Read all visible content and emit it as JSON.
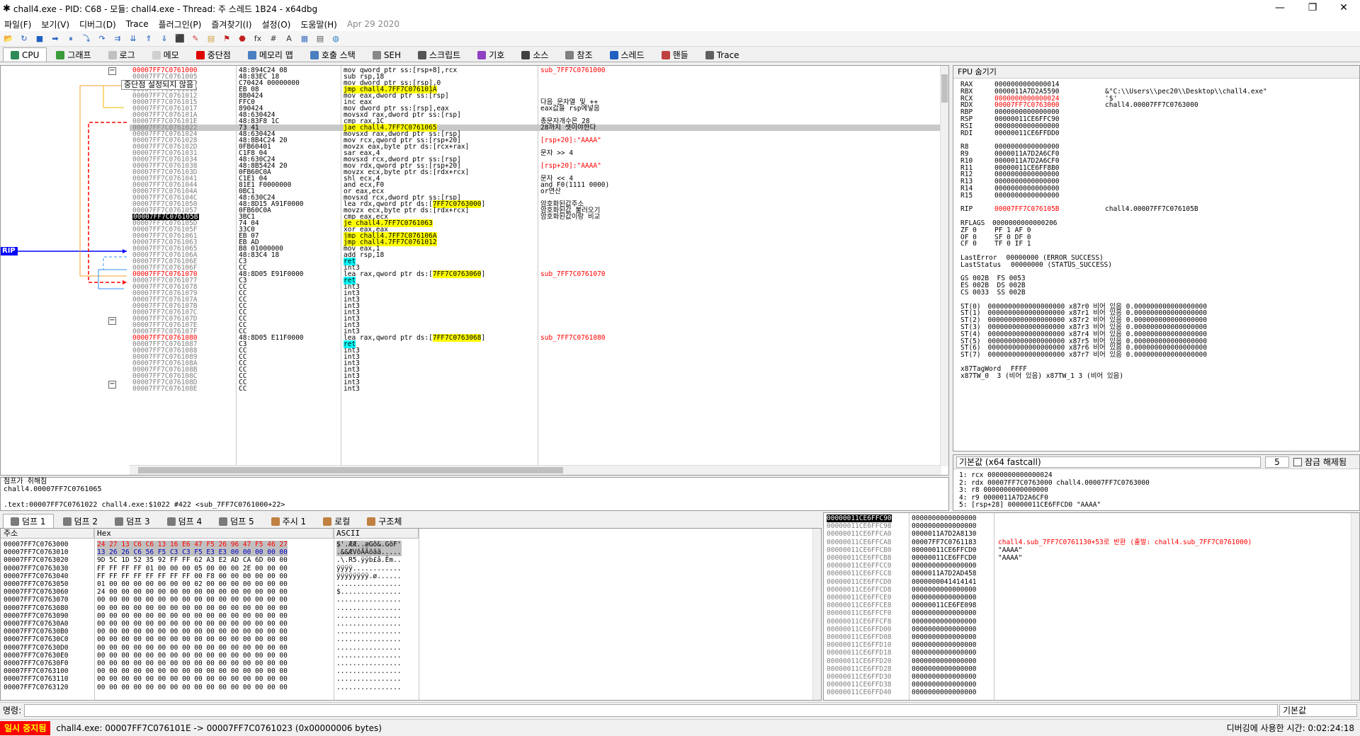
{
  "window": {
    "title": "chall4.exe - PID: C68 - 모듈: chall4.exe - Thread: 주 스레드 1B24 - x64dbg",
    "minimize": "—",
    "maximize": "❐",
    "close": "✕"
  },
  "menu": [
    "파일(F)",
    "보기(V)",
    "디버그(D)",
    "Trace",
    "플러그인(P)",
    "즐겨찾기(I)",
    "설정(O)",
    "도움말(H)"
  ],
  "build_date": "Apr 29 2020",
  "toolbar_icons": [
    "open-icon",
    "restart-icon",
    "stop-icon",
    "run-icon",
    "pause-icon",
    "step-into-icon",
    "step-over-icon",
    "trace-into-icon",
    "trace-over-icon",
    "execute-till-return-icon",
    "skip-icon",
    "breakpoint-icon",
    "patch-icon",
    "memory-icon",
    "script-icon",
    "hardware-bp-icon",
    "function-icon",
    "hash-icon",
    "font-icon",
    "calc-icon",
    "log-icon",
    "globe-icon"
  ],
  "toolbar_glyphs": [
    "📂",
    "↻",
    "■",
    "➡",
    "⏸",
    "⤵",
    "↷",
    "⇉",
    "⇊",
    "⇑",
    "⇓",
    "⬛",
    "✎",
    "▤",
    "⚑",
    "⬣",
    "fx",
    "#",
    "A",
    "▦",
    "▤",
    "◍"
  ],
  "tabs": [
    {
      "label": "CPU",
      "color": "#2e8b57"
    },
    {
      "label": "그래프",
      "color": "#3a9a3a"
    },
    {
      "label": "로그",
      "color": "#c0c0c0"
    },
    {
      "label": "메모",
      "color": "#d0d0d0"
    },
    {
      "label": "중단점",
      "color": "#e00000"
    },
    {
      "label": "메모리 맵",
      "color": "#4a7fc0"
    },
    {
      "label": "호출 스택",
      "color": "#4a7fc0"
    },
    {
      "label": "SEH",
      "color": "#888888"
    },
    {
      "label": "스크립트",
      "color": "#555555"
    },
    {
      "label": "기호",
      "color": "#9040c0"
    },
    {
      "label": "소스",
      "color": "#404040"
    },
    {
      "label": "참조",
      "color": "#808080"
    },
    {
      "label": "스레드",
      "color": "#2060c0"
    },
    {
      "label": "핸들",
      "color": "#c04040"
    },
    {
      "label": "Trace",
      "color": "#606060"
    }
  ],
  "tooltip": "중단점 설정되지 않음",
  "rip_label": "RIP",
  "disasm": [
    {
      "addr": "00007FF7C0761000",
      "bytes": "48:894C24 08",
      "ins": "mov qword ptr ss:[rsp+8],rcx",
      "cmt": "sub_7FF7C0761000",
      "addr_style": "red",
      "cmt_style": "red"
    },
    {
      "addr": "00007FF7C0761005",
      "bytes": "48:83EC 18",
      "ins": "sub rsp,18",
      "cmt": ""
    },
    {
      "addr": "00007FF7C0761009",
      "bytes": "C70424 00000000",
      "ins": "mov dword ptr ss:[rsp],0",
      "cmt": ""
    },
    {
      "addr": "00007FF7C0761010",
      "bytes": "EB 08",
      "ins": "jmp chall4.7FF7C076101A",
      "cmt": "",
      "ins_style": "jmp"
    },
    {
      "addr": "00007FF7C0761012",
      "bytes": "8B0424",
      "ins": "mov eax,dword ptr ss:[rsp]",
      "cmt": ""
    },
    {
      "addr": "00007FF7C0761015",
      "bytes": "FFC0",
      "ins": "inc eax",
      "cmt": "다음 문자열 및 ++"
    },
    {
      "addr": "00007FF7C0761017",
      "bytes": "890424",
      "ins": "mov dword ptr ss:[rsp],eax",
      "cmt": "eax값을 rsp에넣음"
    },
    {
      "addr": "00007FF7C076101A",
      "bytes": "48:630424",
      "ins": "movsxd rax,dword ptr ss:[rsp]",
      "cmt": ""
    },
    {
      "addr": "00007FF7C076101E",
      "bytes": "48:83F8 1C",
      "ins": "cmp rax,1C",
      "cmt": "총문자개수은 28"
    },
    {
      "addr": "00007FF7C0761022",
      "bytes": "73 41",
      "ins": "jae chall4.7FF7C0761065",
      "cmt": "28까지 셋이야한다",
      "ins_style": "jmp",
      "row_style": "hl"
    },
    {
      "addr": "00007FF7C0761024",
      "bytes": "48:630424",
      "ins": "movsxd rax,dword ptr ss:[rsp]",
      "cmt": ""
    },
    {
      "addr": "00007FF7C0761028",
      "bytes": "48:8B4C24 20",
      "ins": "mov rcx,qword ptr ss:[rsp+20]",
      "cmt": "[rsp+20]:\"AAAA\"",
      "cmt_style": "red"
    },
    {
      "addr": "00007FF7C076102D",
      "bytes": "0FB60401",
      "ins": "movzx eax,byte ptr ds:[rcx+rax]",
      "cmt": ""
    },
    {
      "addr": "00007FF7C0761031",
      "bytes": "C1F8 04",
      "ins": "sar eax,4",
      "cmt": "문자 >> 4"
    },
    {
      "addr": "00007FF7C0761034",
      "bytes": "48:630C24",
      "ins": "movsxd rcx,dword ptr ss:[rsp]",
      "cmt": ""
    },
    {
      "addr": "00007FF7C0761038",
      "bytes": "48:8B5424 20",
      "ins": "mov rdx,qword ptr ss:[rsp+20]",
      "cmt": "[rsp+20]:\"AAAA\"",
      "cmt_style": "red"
    },
    {
      "addr": "00007FF7C076103D",
      "bytes": "0FB60C0A",
      "ins": "movzx ecx,byte ptr ds:[rdx+rcx]",
      "cmt": ""
    },
    {
      "addr": "00007FF7C0761041",
      "bytes": "C1E1 04",
      "ins": "shl ecx,4",
      "cmt": "문자 << 4"
    },
    {
      "addr": "00007FF7C0761044",
      "bytes": "81E1 F0000000",
      "ins": "and ecx,F0",
      "cmt": "and F0(1111 0000)"
    },
    {
      "addr": "00007FF7C076104A",
      "bytes": "0BC1",
      "ins": "or eax,ecx",
      "cmt": " or연산"
    },
    {
      "addr": "00007FF7C076104C",
      "bytes": "48:630C24",
      "ins": "movsxd rcx,dword ptr ss:[rsp]",
      "cmt": ""
    },
    {
      "addr": "00007FF7C0761050",
      "bytes": "48:8D15 A91F0000",
      "ins": "lea rdx,qword ptr ds:[7FF7C0763000]",
      "cmt": "암호화된값주소",
      "ins_style": "addr"
    },
    {
      "addr": "00007FF7C0761057",
      "bytes": "0FB60C0A",
      "ins": "movzx ecx,byte ptr ds:[rdx+rcx]",
      "cmt": "암호화된값 불러오기"
    },
    {
      "addr": "00007FF7C076105B",
      "bytes": "3BC1",
      "ins": "cmp eax,ecx",
      "cmt": "암호화된값이랑 비교",
      "addr_style": "rip"
    },
    {
      "addr": "00007FF7C076105D",
      "bytes": "74 04",
      "ins": "je chall4.7FF7C0761063",
      "cmt": "",
      "ins_style": "jmp"
    },
    {
      "addr": "00007FF7C076105F",
      "bytes": "33C0",
      "ins": "xor eax,eax",
      "cmt": ""
    },
    {
      "addr": "00007FF7C0761061",
      "bytes": "EB 07",
      "ins": "jmp chall4.7FF7C076106A",
      "cmt": "",
      "ins_style": "jmp"
    },
    {
      "addr": "00007FF7C0761063",
      "bytes": "EB AD",
      "ins": "jmp chall4.7FF7C0761012",
      "cmt": "",
      "ins_style": "jmp"
    },
    {
      "addr": "00007FF7C0761065",
      "bytes": "B8 01000000",
      "ins": "mov eax,1",
      "cmt": ""
    },
    {
      "addr": "00007FF7C076106A",
      "bytes": "48:83C4 18",
      "ins": "add rsp,18",
      "cmt": ""
    },
    {
      "addr": "00007FF7C076106E",
      "bytes": "C3",
      "ins": "ret",
      "cmt": "",
      "ins_style": "ret"
    },
    {
      "addr": "00007FF7C076106F",
      "bytes": "CC",
      "ins": "int3",
      "cmt": ""
    },
    {
      "addr": "00007FF7C0761070",
      "bytes": "48:8D05 E91F0000",
      "ins": "lea rax,qword ptr ds:[7FF7C0763060]",
      "cmt": "sub_7FF7C0761070",
      "addr_style": "red",
      "cmt_style": "red",
      "ins_style": "addr"
    },
    {
      "addr": "00007FF7C0761077",
      "bytes": "C3",
      "ins": "ret",
      "cmt": "",
      "ins_style": "ret"
    },
    {
      "addr": "00007FF7C0761078",
      "bytes": "CC",
      "ins": "int3",
      "cmt": ""
    },
    {
      "addr": "00007FF7C0761079",
      "bytes": "CC",
      "ins": "int3",
      "cmt": ""
    },
    {
      "addr": "00007FF7C076107A",
      "bytes": "CC",
      "ins": "int3",
      "cmt": ""
    },
    {
      "addr": "00007FF7C076107B",
      "bytes": "CC",
      "ins": "int3",
      "cmt": ""
    },
    {
      "addr": "00007FF7C076107C",
      "bytes": "CC",
      "ins": "int3",
      "cmt": ""
    },
    {
      "addr": "00007FF7C076107D",
      "bytes": "CC",
      "ins": "int3",
      "cmt": ""
    },
    {
      "addr": "00007FF7C076107E",
      "bytes": "CC",
      "ins": "int3",
      "cmt": ""
    },
    {
      "addr": "00007FF7C076107F",
      "bytes": "CC",
      "ins": "int3",
      "cmt": ""
    },
    {
      "addr": "00007FF7C0761080",
      "bytes": "48:8D05 E11F0000",
      "ins": "lea rax,qword ptr ds:[7FF7C0763068]",
      "cmt": "sub_7FF7C0761080",
      "addr_style": "red",
      "cmt_style": "red",
      "ins_style": "addr"
    },
    {
      "addr": "00007FF7C0761087",
      "bytes": "C3",
      "ins": "ret",
      "cmt": "",
      "ins_style": "ret"
    },
    {
      "addr": "00007FF7C0761088",
      "bytes": "CC",
      "ins": "int3",
      "cmt": ""
    },
    {
      "addr": "00007FF7C0761089",
      "bytes": "CC",
      "ins": "int3",
      "cmt": ""
    },
    {
      "addr": "00007FF7C076108A",
      "bytes": "CC",
      "ins": "int3",
      "cmt": ""
    },
    {
      "addr": "00007FF7C076108B",
      "bytes": "CC",
      "ins": "int3",
      "cmt": ""
    },
    {
      "addr": "00007FF7C076108C",
      "bytes": "CC",
      "ins": "int3",
      "cmt": ""
    },
    {
      "addr": "00007FF7C076108D",
      "bytes": "CC",
      "ins": "int3",
      "cmt": ""
    },
    {
      "addr": "00007FF7C076108E",
      "bytes": "CC",
      "ins": "int3",
      "cmt": ""
    }
  ],
  "registers": {
    "header": "FPU 숨기기",
    "rows": [
      {
        "name": "RAX",
        "value": "0000000000000014",
        "info": ""
      },
      {
        "name": "RBX",
        "value": "0000011A7D2A5590",
        "info": "&\"C:\\\\Users\\\\pec20\\\\Desktop\\\\chall4.exe\""
      },
      {
        "name": "RCX",
        "value": "0000000000000024",
        "info": "'$'",
        "changed": true
      },
      {
        "name": "RDX",
        "value": "00007FF7C0763000",
        "info": "chall4.00007FF7C0763000",
        "changed": true
      },
      {
        "name": "RBP",
        "value": "0000000000000000",
        "info": ""
      },
      {
        "name": "RSP",
        "value": "00000011CE6FFC90",
        "info": ""
      },
      {
        "name": "RSI",
        "value": "0000000000000000",
        "info": ""
      },
      {
        "name": "RDI",
        "value": "00000011CE6FFDD0",
        "info": ""
      },
      {
        "name": "",
        "value": "",
        "info": ""
      },
      {
        "name": "R8",
        "value": "0000000000000000",
        "info": ""
      },
      {
        "name": "R9",
        "value": "0000011A7D2A6CF0",
        "info": ""
      },
      {
        "name": "R10",
        "value": "0000011A7D2A6CF0",
        "info": ""
      },
      {
        "name": "R11",
        "value": "00000011CE6FF8B0",
        "info": ""
      },
      {
        "name": "R12",
        "value": "0000000000000000",
        "info": ""
      },
      {
        "name": "R13",
        "value": "0000000000000000",
        "info": ""
      },
      {
        "name": "R14",
        "value": "0000000000000000",
        "info": ""
      },
      {
        "name": "R15",
        "value": "0000000000000000",
        "info": ""
      },
      {
        "name": "",
        "value": "",
        "info": ""
      },
      {
        "name": "RIP",
        "value": "00007FF7C076105B",
        "info": "chall4.00007FF7C076105B",
        "changed": true
      },
      {
        "name": "",
        "value": "",
        "info": ""
      },
      {
        "name": "RFLAGS",
        "value": "0000000000000206",
        "info": ""
      },
      {
        "name": "ZF 0",
        "value": "PF 1  AF 0",
        "info": ""
      },
      {
        "name": "OF 0",
        "value": "SF 0  DF 0",
        "info": ""
      },
      {
        "name": "CF 0",
        "value": "TF 0  IF 1",
        "info": ""
      },
      {
        "name": "",
        "value": "",
        "info": ""
      },
      {
        "name": "LastError",
        "value": "00000000 (ERROR_SUCCESS)",
        "info": ""
      },
      {
        "name": "LastStatus",
        "value": "00000000 (STATUS_SUCCESS)",
        "info": ""
      },
      {
        "name": "",
        "value": "",
        "info": ""
      },
      {
        "name": "GS 002B",
        "value": "FS 0053",
        "info": ""
      },
      {
        "name": "ES 002B",
        "value": "DS 002B",
        "info": ""
      },
      {
        "name": "CS 0033",
        "value": "SS 002B",
        "info": ""
      },
      {
        "name": "",
        "value": "",
        "info": ""
      },
      {
        "name": "ST(0)",
        "value": "0000000000000000000 x87r0 비어 있음 0.000000000000000000",
        "info": ""
      },
      {
        "name": "ST(1)",
        "value": "0000000000000000000 x87r1 비어 있음 0.000000000000000000",
        "info": ""
      },
      {
        "name": "ST(2)",
        "value": "0000000000000000000 x87r2 비어 있음 0.000000000000000000",
        "info": ""
      },
      {
        "name": "ST(3)",
        "value": "0000000000000000000 x87r3 비어 있음 0.000000000000000000",
        "info": ""
      },
      {
        "name": "ST(4)",
        "value": "0000000000000000000 x87r4 비어 있음 0.000000000000000000",
        "info": ""
      },
      {
        "name": "ST(5)",
        "value": "0000000000000000000 x87r5 비어 있음 0.000000000000000000",
        "info": ""
      },
      {
        "name": "ST(6)",
        "value": "0000000000000000000 x87r6 비어 있음 0.000000000000000000",
        "info": ""
      },
      {
        "name": "ST(7)",
        "value": "0000000000000000000 x87r7 비어 있음 0.000000000000000000",
        "info": ""
      },
      {
        "name": "",
        "value": "",
        "info": ""
      },
      {
        "name": "x87TagWord",
        "value": "FFFF",
        "info": ""
      },
      {
        "name": "x87TW_0",
        "value": "3 (비어 있음) x87TW_1 3 (비어 있음)",
        "info": ""
      }
    ]
  },
  "callconv": {
    "select": "기본값 (x64 fastcall)",
    "count": "5",
    "lock_label": "잠금 해제됨",
    "args": [
      "1: rcx 0000000000000024",
      "2: rdx 00007FF7C0763000 chall4.00007FF7C0763000",
      "3: r8 0000000000000000",
      "4: r9 0000011A7D2A6CF0",
      "5: [rsp+28] 00000011CE6FFCD0 \"AAAA\""
    ]
  },
  "info_lines": [
    "점프가 취해짐",
    "chall4.00007FF7C0761065",
    "",
    ".text:00007FF7C0761022 chall4.exe:$1022 #422 <sub_7FF7C0761000+22>"
  ],
  "dump_tabs": [
    "덤프 1",
    "덤프 2",
    "덤프 3",
    "덤프 4",
    "덤프 5",
    "주시 1",
    "로컬",
    "구조체"
  ],
  "dump_headers": {
    "addr": "주소",
    "hex": "Hex",
    "ascii": "ASCII"
  },
  "dump_rows": [
    {
      "addr": "00007FF7C0763000",
      "hex": "24 27 13 C6 C6 13 16 E6 47 F5 26 96 47 F5 46 27",
      "ascii": "$'.ÆÆ..æGõ&.GõF'"
    },
    {
      "addr": "00007FF7C0763010",
      "hex": "13 26 26 C6 56 F5 C3 C3 F5 E3 E3 00 00 00 00 00",
      "ascii": ".&&ÆVõÃÃõãã....."
    },
    {
      "addr": "00007FF7C0763020",
      "hex": "9D 5C 1D 52 35 92 FF FF 62 A3 E2 AD CA 6D 00 00",
      "ascii": ".\\.R5.ÿÿb£â.Êm.."
    },
    {
      "addr": "00007FF7C0763030",
      "hex": "FF FF FF FF 01 00 00 00 05 00 00 00 2E 00 00 00",
      "ascii": "ÿÿÿÿ............"
    },
    {
      "addr": "00007FF7C0763040",
      "hex": "FF FF FF FF FF FF FF FF 00 F8 00 00 00 00 00 00",
      "ascii": "ÿÿÿÿÿÿÿÿ.ø......"
    },
    {
      "addr": "00007FF7C0763050",
      "hex": "01 00 00 00 00 00 00 00 02 00 00 00 00 00 00 00",
      "ascii": "................"
    },
    {
      "addr": "00007FF7C0763060",
      "hex": "24 00 00 00 00 00 00 00 00 00 00 00 00 00 00 00",
      "ascii": "$..............."
    },
    {
      "addr": "00007FF7C0763070",
      "hex": "00 00 00 00 00 00 00 00 00 00 00 00 00 00 00 00",
      "ascii": "................"
    },
    {
      "addr": "00007FF7C0763080",
      "hex": "00 00 00 00 00 00 00 00 00 00 00 00 00 00 00 00",
      "ascii": "................"
    },
    {
      "addr": "00007FF7C0763090",
      "hex": "00 00 00 00 00 00 00 00 00 00 00 00 00 00 00 00",
      "ascii": "................"
    },
    {
      "addr": "00007FF7C07630A0",
      "hex": "00 00 00 00 00 00 00 00 00 00 00 00 00 00 00 00",
      "ascii": "................"
    },
    {
      "addr": "00007FF7C07630B0",
      "hex": "00 00 00 00 00 00 00 00 00 00 00 00 00 00 00 00",
      "ascii": "................"
    },
    {
      "addr": "00007FF7C07630C0",
      "hex": "00 00 00 00 00 00 00 00 00 00 00 00 00 00 00 00",
      "ascii": "................"
    },
    {
      "addr": "00007FF7C07630D0",
      "hex": "00 00 00 00 00 00 00 00 00 00 00 00 00 00 00 00",
      "ascii": "................"
    },
    {
      "addr": "00007FF7C07630E0",
      "hex": "00 00 00 00 00 00 00 00 00 00 00 00 00 00 00 00",
      "ascii": "................"
    },
    {
      "addr": "00007FF7C07630F0",
      "hex": "00 00 00 00 00 00 00 00 00 00 00 00 00 00 00 00",
      "ascii": "................"
    },
    {
      "addr": "00007FF7C0763100",
      "hex": "00 00 00 00 00 00 00 00 00 00 00 00 00 00 00 00",
      "ascii": "................"
    },
    {
      "addr": "00007FF7C0763110",
      "hex": "00 00 00 00 00 00 00 00 00 00 00 00 00 00 00 00",
      "ascii": "................"
    },
    {
      "addr": "00007FF7C0763120",
      "hex": "00 00 00 00 00 00 00 00 00 00 00 00 00 00 00 00",
      "ascii": "................"
    }
  ],
  "stack_rows": [
    {
      "addr": "00000011CE6FFC90",
      "value": "0000000000000000",
      "cmt": "",
      "current": true
    },
    {
      "addr": "00000011CE6FFC98",
      "value": "0000000000000000",
      "cmt": ""
    },
    {
      "addr": "00000011CE6FFCA0",
      "value": "0000011A7D2A8130",
      "cmt": ""
    },
    {
      "addr": "00000011CE6FFCA8",
      "value": "00007FF7C0761183",
      "cmt": "chall4.sub_7FF7C0761130+53로 반환 (출발: chall4.sub_7FF7C0761000)",
      "cmt_red": true
    },
    {
      "addr": "00000011CE6FFCB0",
      "value": "00000011CE6FFCD0",
      "cmt": "\"AAAA\""
    },
    {
      "addr": "00000011CE6FFCB8",
      "value": "00000011CE6FFCD0",
      "cmt": "\"AAAA\""
    },
    {
      "addr": "00000011CE6FFCC0",
      "value": "0000000000000000",
      "cmt": ""
    },
    {
      "addr": "00000011CE6FFCC8",
      "value": "0000011A7D2AD458",
      "cmt": ""
    },
    {
      "addr": "00000011CE6FFCD0",
      "value": "0000000041414141",
      "cmt": ""
    },
    {
      "addr": "00000011CE6FFCD8",
      "value": "0000000000000000",
      "cmt": ""
    },
    {
      "addr": "00000011CE6FFCE0",
      "value": "0000000000000000",
      "cmt": ""
    },
    {
      "addr": "00000011CE6FFCE8",
      "value": "00000011CE6FE098",
      "cmt": ""
    },
    {
      "addr": "00000011CE6FFCF0",
      "value": "0000000000000000",
      "cmt": ""
    },
    {
      "addr": "00000011CE6FFCF8",
      "value": "0000000000000000",
      "cmt": ""
    },
    {
      "addr": "00000011CE6FFD00",
      "value": "0000000000000000",
      "cmt": ""
    },
    {
      "addr": "00000011CE6FFD08",
      "value": "0000000000000000",
      "cmt": ""
    },
    {
      "addr": "00000011CE6FFD10",
      "value": "0000000000000000",
      "cmt": ""
    },
    {
      "addr": "00000011CE6FFD18",
      "value": "0000000000000000",
      "cmt": ""
    },
    {
      "addr": "00000011CE6FFD20",
      "value": "0000000000000000",
      "cmt": ""
    },
    {
      "addr": "00000011CE6FFD28",
      "value": "0000000000000000",
      "cmt": ""
    },
    {
      "addr": "00000011CE6FFD30",
      "value": "0000000000000000",
      "cmt": ""
    },
    {
      "addr": "00000011CE6FFD38",
      "value": "0000000000000000",
      "cmt": ""
    },
    {
      "addr": "00000011CE6FFD40",
      "value": "0000000000000000",
      "cmt": ""
    }
  ],
  "command": {
    "label": "명령:",
    "value": "",
    "mode": "기본값"
  },
  "status": {
    "state": "일시 중지됨",
    "message": "chall4.exe: 00007FF7C076101E -> 00007FF7C0761023 (0x00000006 bytes)",
    "time_label": "디버깅에 사용한 시간: 0:02:24:18"
  }
}
